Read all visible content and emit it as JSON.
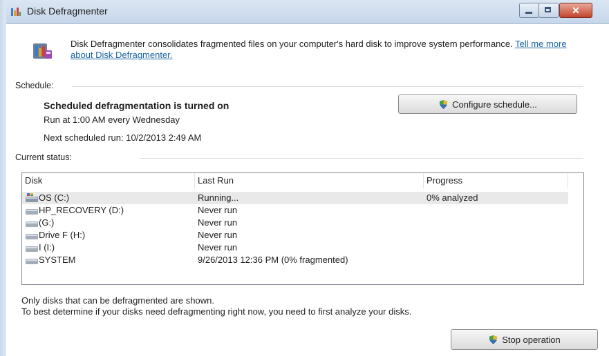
{
  "window": {
    "title": "Disk Defragmenter"
  },
  "intro": {
    "text": "Disk Defragmenter consolidates fragmented files on your computer's hard disk to improve system performance.",
    "link": "Tell me more about Disk Defragmenter."
  },
  "schedule": {
    "label": "Schedule:",
    "status": "Scheduled defragmentation is turned on",
    "run_at": "Run at 1:00 AM every Wednesday",
    "next_run": "Next scheduled run: 10/2/2013 2:49 AM",
    "configure_button": "Configure schedule..."
  },
  "current_status": {
    "label": "Current status:",
    "columns": [
      "Disk",
      "Last Run",
      "Progress"
    ],
    "rows": [
      {
        "disk": "OS (C:)",
        "last_run": "Running...",
        "progress": "0% analyzed",
        "icon": "system-drive-icon"
      },
      {
        "disk": "HP_RECOVERY (D:)",
        "last_run": "Never run",
        "progress": "",
        "icon": "drive-icon"
      },
      {
        "disk": "(G:)",
        "last_run": "Never run",
        "progress": "",
        "icon": "drive-icon"
      },
      {
        "disk": "Drive F (H:)",
        "last_run": "Never run",
        "progress": "",
        "icon": "drive-icon"
      },
      {
        "disk": "I (I:)",
        "last_run": "Never run",
        "progress": "",
        "icon": "drive-icon"
      },
      {
        "disk": "SYSTEM",
        "last_run": "9/26/2013 12:36 PM (0% fragmented)",
        "progress": "",
        "icon": "drive-icon"
      }
    ]
  },
  "footer": {
    "line1": "Only disks that can be defragmented are shown.",
    "line2": "To best determine if your disks need defragmenting right now, you need to first analyze your disks."
  },
  "stop_button": "Stop operation"
}
